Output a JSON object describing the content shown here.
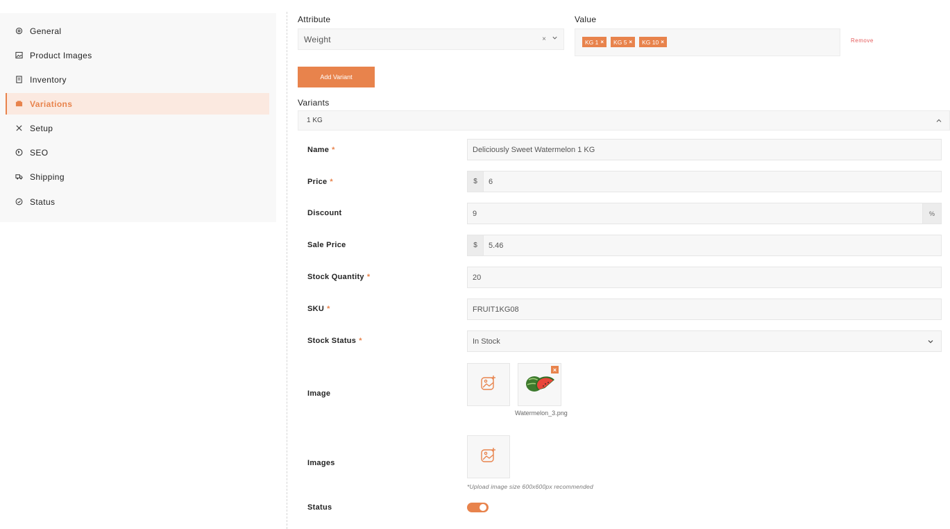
{
  "sidebar": {
    "items": [
      {
        "label": "General",
        "icon": "settings-icon"
      },
      {
        "label": "Product Images",
        "icon": "image-icon"
      },
      {
        "label": "Inventory",
        "icon": "inventory-icon"
      },
      {
        "label": "Variations",
        "icon": "variations-icon",
        "active": true
      },
      {
        "label": "Setup",
        "icon": "tools-icon"
      },
      {
        "label": "SEO",
        "icon": "globe-icon"
      },
      {
        "label": "Shipping",
        "icon": "truck-icon"
      },
      {
        "label": "Status",
        "icon": "check-circle-icon"
      }
    ]
  },
  "attribute": {
    "label": "Attribute",
    "value": "Weight",
    "clear": "×"
  },
  "value": {
    "label": "Value",
    "tags": [
      "KG 1",
      "KG 5",
      "KG 10"
    ],
    "tag_remove": "×"
  },
  "remove_label": "Remove",
  "add_variant_label": "Add Variant",
  "variants": {
    "label": "Variants",
    "active_variant": "1 KG"
  },
  "form": {
    "name": {
      "label": "Name",
      "value": "Deliciously Sweet Watermelon 1 KG",
      "required": "*"
    },
    "price": {
      "label": "Price",
      "prefix": "$",
      "value": "6",
      "required": "*"
    },
    "discount": {
      "label": "Discount",
      "value": "9",
      "suffix": "%"
    },
    "sale_price": {
      "label": "Sale Price",
      "prefix": "$",
      "value": "5.46"
    },
    "stock_quantity": {
      "label": "Stock Quantity",
      "value": "20",
      "required": "*"
    },
    "sku": {
      "label": "SKU",
      "value": "FRUIT1KG08",
      "required": "*"
    },
    "stock_status": {
      "label": "Stock Status",
      "value": "In Stock",
      "required": "*"
    },
    "image": {
      "label": "Image",
      "file_name": "Watermelon_3.png",
      "remove": "×"
    },
    "images": {
      "label": "Images",
      "hint": "*Upload image size 600x600px recommended"
    },
    "status": {
      "label": "Status",
      "enabled": true
    }
  },
  "colors": {
    "accent": "#e8834c",
    "accent_light": "#fbe9e0",
    "danger": "#e55c5c",
    "field_bg": "#f7f7f7"
  }
}
